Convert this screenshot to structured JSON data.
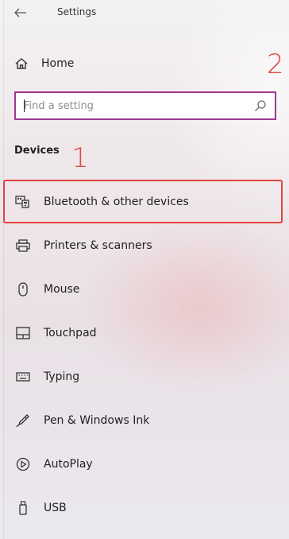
{
  "window": {
    "title": "Settings"
  },
  "home": {
    "label": "Home"
  },
  "search": {
    "placeholder": "Find a setting",
    "value": ""
  },
  "section": {
    "title": "Devices"
  },
  "annotations": {
    "one": "1",
    "two": "2"
  },
  "nav": {
    "items": [
      {
        "label": "Bluetooth & other devices",
        "icon": "bluetooth-devices-icon",
        "selected": true
      },
      {
        "label": "Printers & scanners",
        "icon": "printer-icon",
        "selected": false
      },
      {
        "label": "Mouse",
        "icon": "mouse-icon",
        "selected": false
      },
      {
        "label": "Touchpad",
        "icon": "touchpad-icon",
        "selected": false
      },
      {
        "label": "Typing",
        "icon": "keyboard-icon",
        "selected": false
      },
      {
        "label": "Pen & Windows Ink",
        "icon": "pen-icon",
        "selected": false
      },
      {
        "label": "AutoPlay",
        "icon": "autoplay-icon",
        "selected": false
      },
      {
        "label": "USB",
        "icon": "usb-icon",
        "selected": false
      }
    ]
  },
  "colors": {
    "highlight": "#e0443e",
    "search_border": "#a0368f",
    "annotation": "#e2483f"
  }
}
